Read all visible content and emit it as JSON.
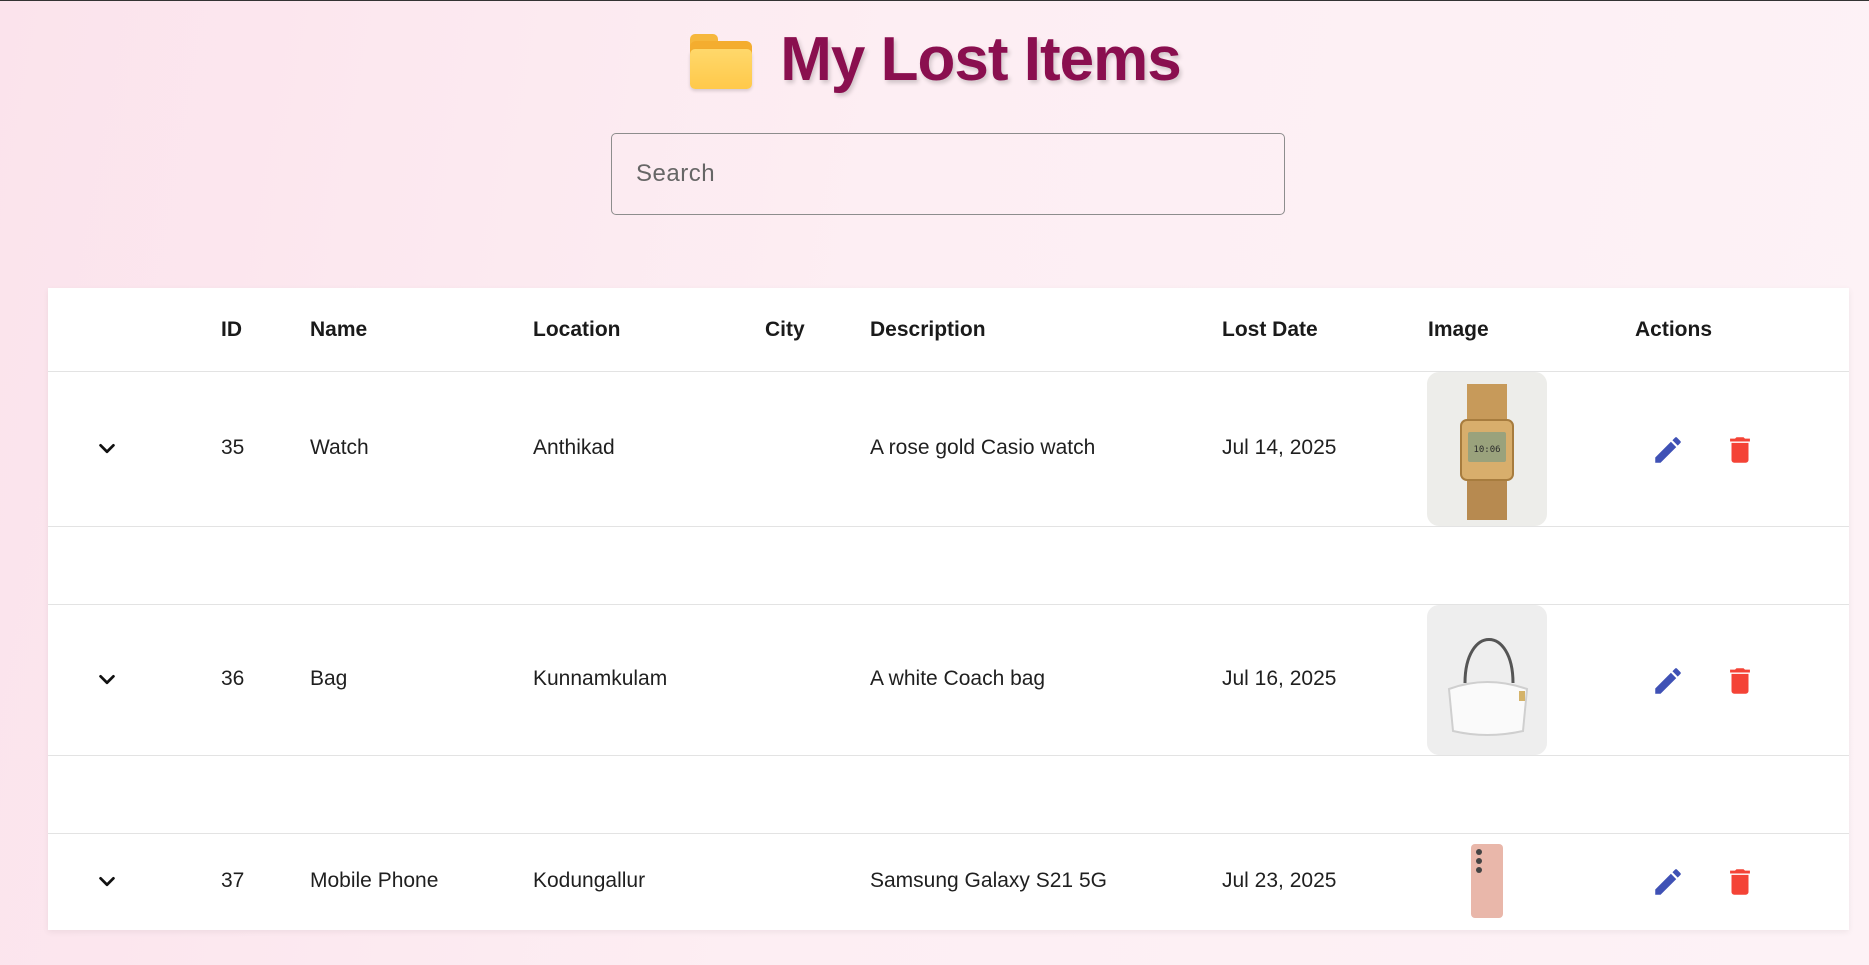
{
  "header": {
    "title": "My Lost Items",
    "icon": "folder-icon"
  },
  "search": {
    "placeholder": "Search",
    "value": ""
  },
  "table": {
    "columns": [
      "ID",
      "Name",
      "Location",
      "City",
      "Description",
      "Lost Date",
      "Image",
      "Actions"
    ],
    "rows": [
      {
        "id": "35",
        "name": "Watch",
        "location": "Anthikad",
        "city": "",
        "description": "A rose gold Casio watch",
        "lost_date": "Jul 14, 2025",
        "image": "watch-photo"
      },
      {
        "id": "36",
        "name": "Bag",
        "location": "Kunnamkulam",
        "city": "",
        "description": "A white Coach bag",
        "lost_date": "Jul 16, 2025",
        "image": "bag-photo"
      },
      {
        "id": "37",
        "name": "Mobile Phone",
        "location": "Kodungallur",
        "city": "",
        "description": "Samsung Galaxy S21 5G",
        "lost_date": "Jul 23, 2025",
        "image": "phone-photo"
      }
    ]
  },
  "colors": {
    "title": "#8a0f4f",
    "edit": "#3f51b5",
    "delete": "#f44336",
    "background": "#fdeef3"
  }
}
